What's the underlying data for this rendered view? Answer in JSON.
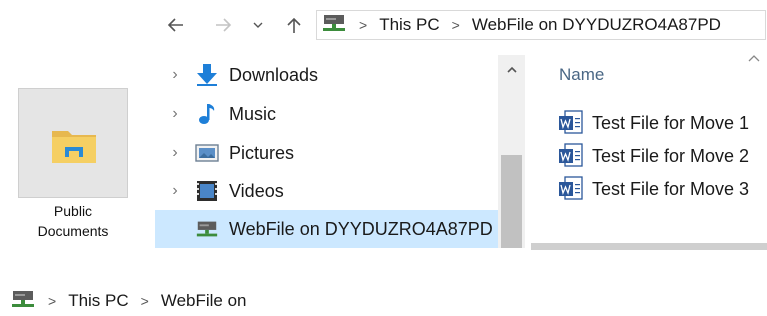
{
  "toolbar": {
    "back_icon": "arrow-left-icon",
    "forward_icon": "arrow-right-icon",
    "recent_icon": "chevron-down-icon",
    "up_icon": "arrow-up-icon"
  },
  "address_bar": {
    "icon": "network-drive-icon",
    "crumbs": [
      "This PC",
      "WebFile on DYYDUZRO4A87PD"
    ]
  },
  "desktop_icon": {
    "icon": "folder-icon",
    "label_line1": "Public",
    "label_line2": "Documents"
  },
  "nav_pane": {
    "items": [
      {
        "label": "Downloads",
        "icon": "download-icon",
        "expandable": true,
        "selected": false
      },
      {
        "label": "Music",
        "icon": "music-icon",
        "expandable": true,
        "selected": false
      },
      {
        "label": "Pictures",
        "icon": "pictures-icon",
        "expandable": true,
        "selected": false
      },
      {
        "label": "Videos",
        "icon": "videos-icon",
        "expandable": true,
        "selected": false
      },
      {
        "label": "WebFile on DYYDUZRO4A87PD",
        "icon": "network-drive-icon",
        "expandable": false,
        "selected": true
      }
    ]
  },
  "content": {
    "column_header": "Name",
    "files": [
      {
        "name": "Test File for Move 1",
        "icon": "word-doc-icon"
      },
      {
        "name": "Test File for Move 2",
        "icon": "word-doc-icon"
      },
      {
        "name": "Test File for Move 3",
        "icon": "word-doc-icon"
      }
    ]
  },
  "bottom_breadcrumb": {
    "icon": "network-drive-icon",
    "crumbs": [
      "This PC",
      "WebFile on"
    ]
  },
  "colors": {
    "selection": "#cce8ff",
    "header_text": "#4a6785",
    "download_blue": "#1e7fd8"
  }
}
